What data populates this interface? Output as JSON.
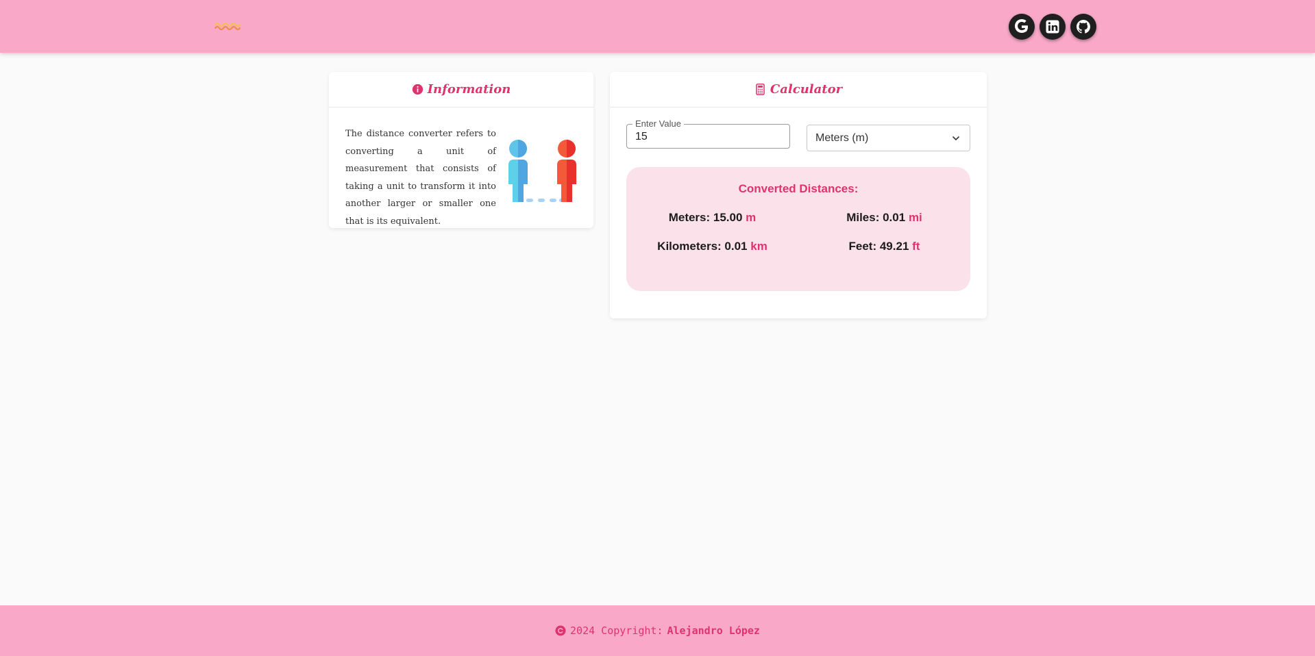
{
  "header": {
    "logo_icon": "wave-logo-icon",
    "social": [
      {
        "name": "google",
        "icon": "google-icon"
      },
      {
        "name": "linkedin",
        "icon": "linkedin-icon"
      },
      {
        "name": "github",
        "icon": "github-icon"
      }
    ]
  },
  "info": {
    "icon": "info-circle-icon",
    "title": "Information",
    "text": "The distance converter refers to converting a unit of measurement that consists of taking a unit to transform it into another larger or smaller one that is its equivalent.",
    "illustration_icon": "two-people-distance-icon"
  },
  "calculator": {
    "icon": "calculator-icon",
    "title": "Calculator",
    "input_label": "Enter Value",
    "input_value": "15",
    "selected_unit": "Meters (m)",
    "results_title": "Converted Distances:",
    "results": {
      "meters_label": "Meters: 15.00",
      "meters_unit": "m",
      "miles_label": "Miles: 0.01",
      "miles_unit": "mi",
      "km_label": "Kilometers: 0.01",
      "km_unit": "km",
      "feet_label": "Feet: 49.21",
      "feet_unit": "ft"
    }
  },
  "footer": {
    "copyright_prefix": "2024 Copyright:",
    "author": "Alejandro López"
  },
  "colors": {
    "header_bg": "#f9a8c8",
    "accent": "#e0336e",
    "results_bg": "#fbe1ea",
    "page_bg": "#fafafa"
  }
}
